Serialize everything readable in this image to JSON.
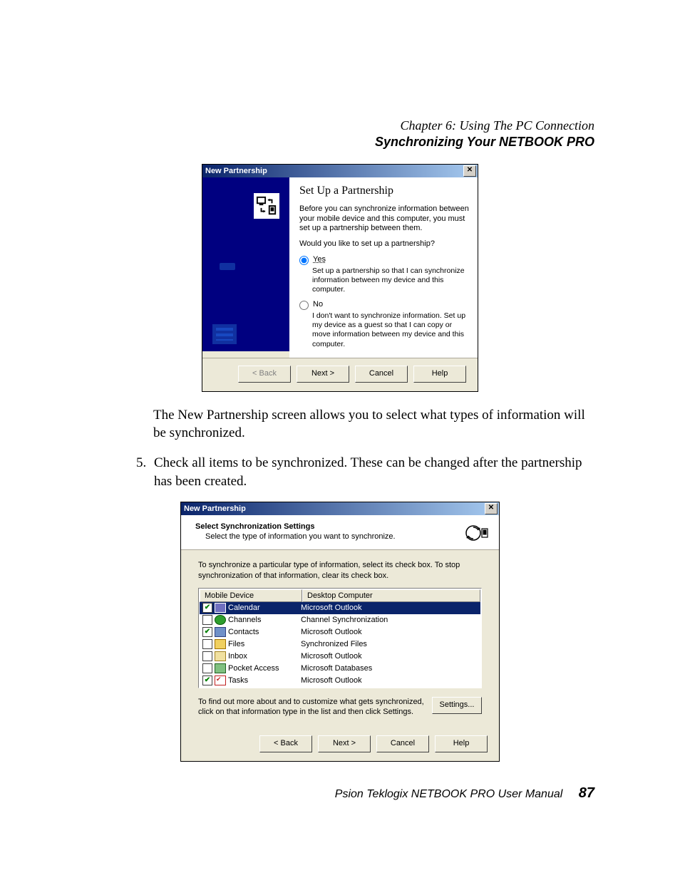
{
  "header": {
    "chapter": "Chapter 6:  Using The PC Connection",
    "section": "Synchronizing Your NETBOOK PRO"
  },
  "para1": "The New Partnership screen allows you to select what types of information will be synchronized.",
  "step5": "Check all items to be synchronized. These can be changed after the partnership has been created.",
  "dlg1": {
    "title": "New Partnership",
    "heading": "Set Up a Partnership",
    "intro": "Before you can synchronize information between your mobile device and this computer, you must set up a partnership between them.",
    "question": "Would you like to set up a partnership?",
    "yes_label": "Yes",
    "yes_desc": "Set up a partnership so that I can synchronize information between my device and this computer.",
    "no_label": "No",
    "no_desc": "I don't want to synchronize information. Set up my device as a guest so that I can copy or move information between my device and this computer.",
    "back": "< Back",
    "next": "Next >",
    "cancel": "Cancel",
    "help": "Help"
  },
  "dlg2": {
    "title": "New Partnership",
    "head_title": "Select Synchronization Settings",
    "head_sub": "Select the type of information you want to synchronize.",
    "intro": "To synchronize a particular type of information, select its check box. To stop synchronization of that information, clear its check box.",
    "col1": "Mobile Device",
    "col2": "Desktop Computer",
    "rows": [
      {
        "checked": true,
        "name": "Calendar",
        "desktop": "Microsoft Outlook",
        "icon": "ic-cal",
        "selected": true
      },
      {
        "checked": false,
        "name": "Channels",
        "desktop": "Channel Synchronization",
        "icon": "ic-chan"
      },
      {
        "checked": true,
        "name": "Contacts",
        "desktop": "Microsoft Outlook",
        "icon": "ic-cont"
      },
      {
        "checked": false,
        "name": "Files",
        "desktop": "Synchronized Files",
        "icon": "ic-files"
      },
      {
        "checked": false,
        "name": "Inbox",
        "desktop": "Microsoft Outlook",
        "icon": "ic-inbox"
      },
      {
        "checked": false,
        "name": "Pocket Access",
        "desktop": "Microsoft Databases",
        "icon": "ic-pa"
      },
      {
        "checked": true,
        "name": "Tasks",
        "desktop": "Microsoft Outlook",
        "icon": "ic-tasks"
      }
    ],
    "hint": "To find out more about and to customize what gets synchronized, click on that information type in the list and then click Settings.",
    "settings": "Settings...",
    "back": "< Back",
    "next": "Next >",
    "cancel": "Cancel",
    "help": "Help"
  },
  "footer": {
    "manual": "Psion Teklogix NETBOOK PRO User Manual",
    "page": "87"
  }
}
